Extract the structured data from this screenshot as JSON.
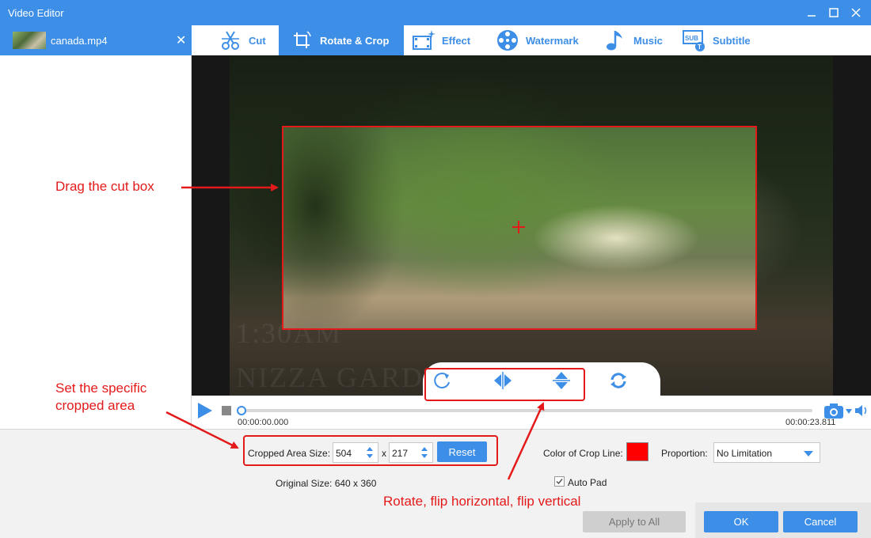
{
  "window": {
    "title": "Video Editor"
  },
  "file": {
    "name": "canada.mp4"
  },
  "tabs": [
    {
      "label": "Cut",
      "icon": "scissors-icon"
    },
    {
      "label": "Rotate & Crop",
      "icon": "crop-rotate-icon"
    },
    {
      "label": "Effect",
      "icon": "effect-icon"
    },
    {
      "label": "Watermark",
      "icon": "film-reel-icon"
    },
    {
      "label": "Music",
      "icon": "music-note-icon"
    },
    {
      "label": "Subtitle",
      "icon": "subtitle-icon"
    }
  ],
  "active_tab": "Rotate & Crop",
  "video": {
    "overlay_line1": "1:30AM",
    "overlay_line2": "NIZZA GARD"
  },
  "timeline": {
    "current": "00:00:00.000",
    "total": "00:00:23.811",
    "progress": 0
  },
  "crop": {
    "label": "Cropped Area Size:",
    "width": "504",
    "x_sep": "x",
    "height": "217",
    "reset_label": "Reset",
    "original_label": "Original Size: 640 x 360"
  },
  "options": {
    "crop_line_label": "Color of Crop Line:",
    "crop_line_color": "#ff0000",
    "proportion_label": "Proportion:",
    "proportion_value": "No Limitation",
    "auto_pad_label": "Auto Pad",
    "auto_pad_checked": true
  },
  "footer": {
    "apply_all": "Apply to All",
    "ok": "OK",
    "cancel": "Cancel"
  },
  "annotations": {
    "drag": "Drag the cut box",
    "set_line1": "Set the specific",
    "set_line2": "cropped area",
    "rotate": "Rotate, flip horizontal, flip vertical"
  },
  "colors": {
    "accent": "#3d8ee6",
    "annotation": "#e41a1a"
  }
}
